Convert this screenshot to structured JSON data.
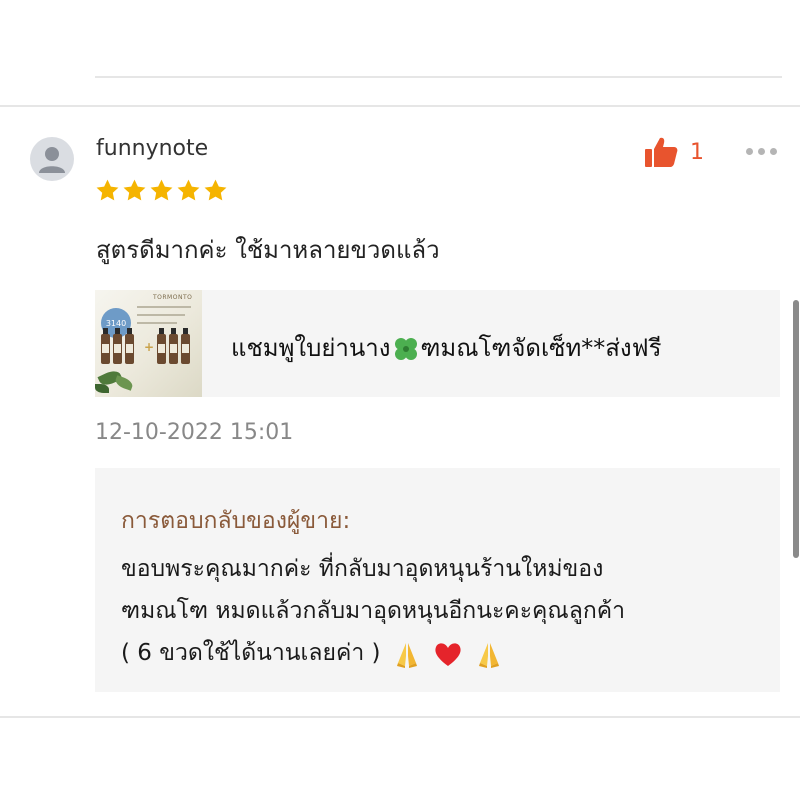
{
  "review": {
    "username": "funnynote",
    "rating": 5,
    "like_count": "1",
    "text": "สูตรดีมากค่ะ ใช้มาหลายขวดแล้ว",
    "timestamp": "12-10-2022 15:01"
  },
  "product": {
    "title_part1": "แชมพูใบย่านาง",
    "title_part2": "ฑมณโฑจัดเซ็ท**ส่งฟรี",
    "thumb_brand": "TORMONTO",
    "thumb_price": "3140"
  },
  "seller_reply": {
    "heading": "การตอบกลับของผู้ขาย:",
    "line1": "ขอบพระคุณมากค่ะ ที่กลับมาอุดหนุนร้านใหม่ของ",
    "line2": "ฑมณโฑ  หมดแล้วกลับมาอุดหนุนอีกนะคะคุณลูกค้า",
    "line3": "( 6 ขวดใช้ได้นานเลยค่า )"
  },
  "icons": {
    "avatar": "user-icon",
    "star": "star-icon",
    "like": "thumbs-up-icon",
    "more": "more-icon",
    "clover": "four-leaf-clover-icon",
    "emoji": [
      "folded-hands-icon",
      "red-heart-icon",
      "folded-hands-icon"
    ]
  },
  "colors": {
    "star": "#f5b400",
    "like": "#e8542e",
    "seller_heading": "#8a5a3a",
    "timestamp": "#888888"
  }
}
